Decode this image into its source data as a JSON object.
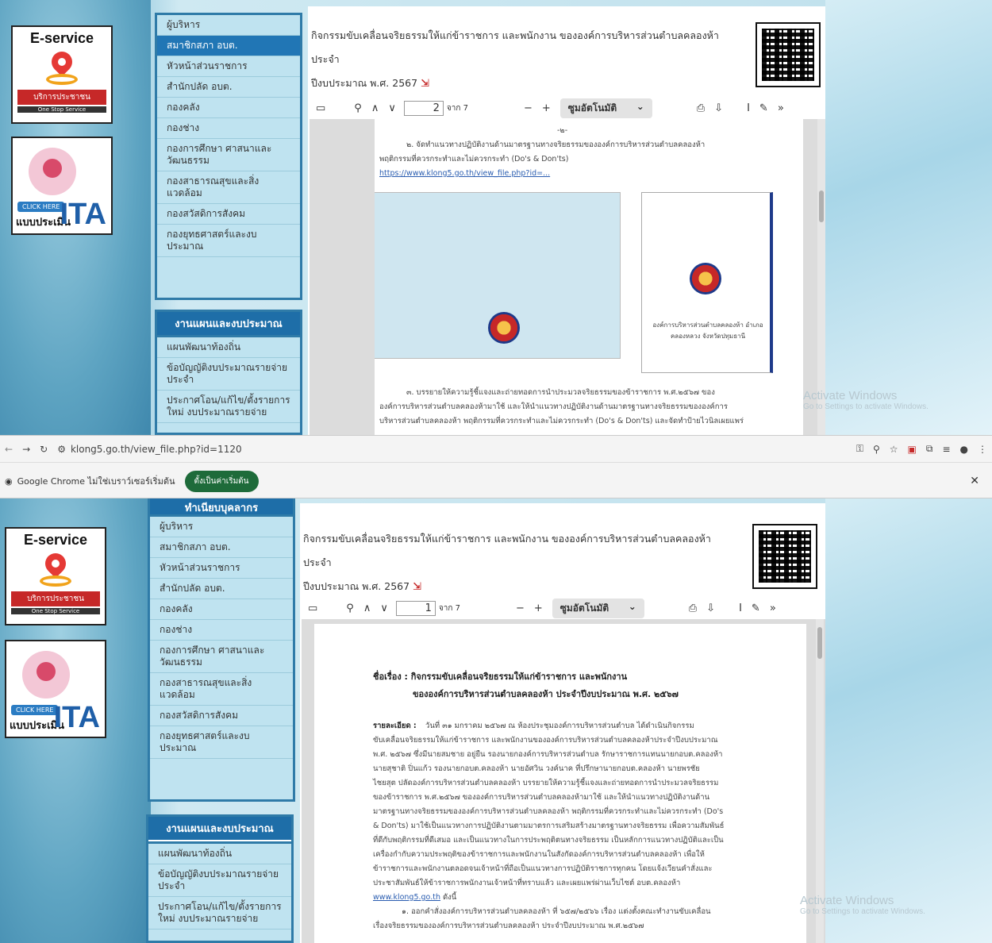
{
  "eservice": {
    "title": "E-service",
    "red": "บริการประชาชน",
    "sub": "One Stop Service"
  },
  "ita": {
    "click": "CLICK HERE",
    "label": "แบบประเมิน",
    "big": "ITA"
  },
  "menu_top_items": [
    "ผู้บริหาร",
    "สมาชิกสภา อบต.",
    "หัวหน้าส่วนราชการ",
    "สำนักปลัด อบต.",
    "กองคลัง",
    "กองช่าง",
    "กองการศึกษา ศาสนาและวัฒนธรรม",
    "กองสาธารณสุขและสิ่งแวดล้อม",
    "กองสวัสดิการสังคม",
    "กองยุทธศาสตร์และงบประมาณ"
  ],
  "menu_section2": {
    "header": "งานแผนและงบประมาณ",
    "items": [
      "แผนพัฒนาท้องถิ่น",
      "ข้อบัญญัติงบประมาณรายจ่ายประจำ",
      "ประกาศโอน/แก้ไข/ตั้งรายการใหม่ งบประมาณรายจ่าย"
    ]
  },
  "menu_bottom_partial_header": "ทำเนียบบุคลากร",
  "doc": {
    "title_line1": "กิจกรรมขับเคลื่อนจริยธรรมให้แก่ข้าราชการ และพนักงาน ขององค์การบริหารส่วนตำบลคลองห้า ประจำ",
    "title_line2": "ปีงบประมาณ พ.ศ. 2567"
  },
  "toolbar": {
    "page_top": "2",
    "page_bottom": "1",
    "of": "จาก 7",
    "zoom": "ซูมอัตโนมัติ"
  },
  "page_top": {
    "header": "-๒-",
    "p1": "๒. จัดทำแนวทางปฏิบัติงานด้านมาตรฐานทางจริยธรรมขององค์การบริหารส่วนตำบลคลองห้า",
    "p2": "พฤติกรรมที่ควรกระทำและไม่ควรกระทำ (Do's & Don'ts)",
    "link": "https://www.klong5.go.th/view_file.php?id=...",
    "poster_org": "องค์การบริหารส่วนตำบลคลองห้า อำเภอคลองหลวง จังหวัดปทุมธานี",
    "p3": "๓. บรรยายให้ความรู้ชี้แจงและถ่ายทอดการนำประมวลจริยธรรมของข้าราชการ พ.ศ.๒๕๖๗ ของ",
    "p4": "องค์การบริหารส่วนตำบลคลองห้ามาใช้ และให้นำแนวทางปฏิบัติงานด้านมาตรฐานทางจริยธรรมขององค์การ",
    "p5": "บริหารส่วนตำบลคลองห้า พฤติกรรมที่ควรกระทำและไม่ควรกระทำ (Do's & Don'ts) และจัดทำป้ายไวนิลเผยแพร่"
  },
  "browser": {
    "url": "klong5.go.th/view_file.php?id=1120",
    "notif": "Google Chrome ไม่ใช่เบราว์เซอร์เริ่มต้น",
    "notif_btn": "ตั้งเป็นค่าเริ่มต้น"
  },
  "page_bottom": {
    "subject": "ชื่อเรื่อง : กิจกรรมขับเคลื่อนจริยธรรมให้แก่ข้าราชการ และพนักงาน",
    "subject2": "ขององค์การบริหารส่วนตำบลคลองห้า ประจำปีงบประมาณ พ.ศ. ๒๕๖๗",
    "detail_label": "รายละเอียด :",
    "body": [
      "วันที่ ๓๑ มกราคม ๒๕๖๗ ณ ห้องประชุมองค์การบริหารส่วนตำบล ได้ดำเนินกิจกรรม",
      "ขับเคลื่อนจริยธรรมให้แก่ข้าราชการ และพนักงานขององค์การบริหารส่วนตำบลคลองห้าประจำปีงบประมาณ",
      "พ.ศ. ๒๕๖๗ ซึ่งมีนายสมชาย อยู่ยืน รองนายกองค์การบริหารส่วนตำบล รักษาราชการแทนนายกอบต.คลองห้า",
      "นายสุชาติ ปิ่นแก้ว รองนายกอบต.คลองห้า นายอัศวิน วงค์นาค ที่ปรึกษานายกอบต.คลองห้า นายพรชัย",
      "ไชยสุต ปลัดองค์การบริหารส่วนตำบลคลองห้า บรรยายให้ความรู้ชี้แจงและถ่ายทอดการนำประมวลจริยธรรม",
      "ของข้าราชการ พ.ศ.๒๕๖๗ ขององค์การบริหารส่วนตำบลคลองห้ามาใช้ และให้นำแนวทางปฏิบัติงานด้าน",
      "มาตรฐานทางจริยธรรมขององค์การบริหารส่วนตำบลคลองห้า พฤติกรรมที่ควรกระทำและไม่ควรกระทำ (Do's",
      "& Don'ts) มาใช้เป็นแนวทางการปฏิบัติงานตามมาตรการเสริมสร้างมาตรฐานทางจริยธรรม เพื่อความสัมพันธ์",
      "ที่ดีกับพฤติกรรมที่ดีเสมอ และเป็นแนวทางในการประพฤติตนทางจริยธรรม เป็นหลักการแนวทางปฏิบัติและเป็น",
      "เครื่องกำกับความประพฤติของข้าราชการและพนักงานในสังกัดองค์การบริหารส่วนตำบลคลองห้า เพื่อให้",
      "ข้าราชการและพนักงานตลอดจนเจ้าหน้าที่ถือเป็นแนวทางการปฏิบัติราชการทุกคน โดยแจ้งเวียนคำสั่งและ",
      "ประชาสัมพันธ์ให้ข้าราชการพนักงานเจ้าหน้าที่ทราบแล้ว และเผยแพร่ผ่านเว็บไซต์ อบต.คลองห้า"
    ],
    "link": "www.klong5.go.th",
    "link_after": "ดังนี้",
    "last": "๑. ออกคำสั่งองค์การบริหารส่วนตำบลคลองห้า ที่ ๖๕๗/๒๕๖๖ เรื่อง แต่งตั้งคณะทำงานขับเคลื่อน",
    "last2": "เรื่องจริยธรรมขององค์การบริหารส่วนตำบลคลองห้า ประจำปีงบประมาณ พ.ศ.๒๕๖๗"
  },
  "activate": {
    "line1": "Activate Windows",
    "line2": "Go to Settings to activate Windows."
  }
}
